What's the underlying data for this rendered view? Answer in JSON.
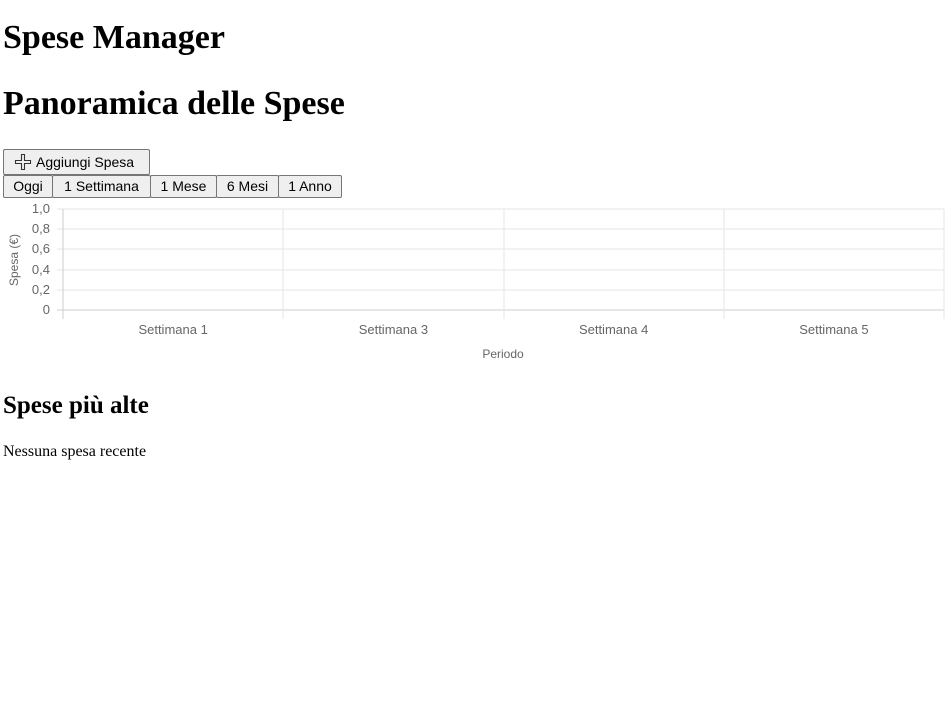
{
  "app": {
    "title": "Spese Manager"
  },
  "overview": {
    "title": "Panoramica delle Spese"
  },
  "actions": {
    "add_label": "Aggiungi Spesa",
    "add_icon": "plus-icon"
  },
  "ranges": [
    {
      "label": "Oggi"
    },
    {
      "label": "1 Settimana"
    },
    {
      "label": "1 Mese"
    },
    {
      "label": "6 Mesi"
    },
    {
      "label": "1 Anno"
    }
  ],
  "chart_data": {
    "type": "line",
    "categories": [
      "Settimana 1",
      "Settimana 3",
      "Settimana 4",
      "Settimana 5"
    ],
    "series": [],
    "xlabel": "Periodo",
    "ylabel": "Spesa (€)",
    "ylim": [
      0,
      1
    ],
    "yticks": [
      "0",
      "0,2",
      "0,4",
      "0,6",
      "0,8",
      "1,0"
    ],
    "grid": true,
    "colors": {
      "grid": "#e6e6e6",
      "axis": "#cccccc",
      "text": "#666666"
    }
  },
  "top_expenses": {
    "title": "Spese più alte",
    "empty_message": "Nessuna spesa recente"
  }
}
